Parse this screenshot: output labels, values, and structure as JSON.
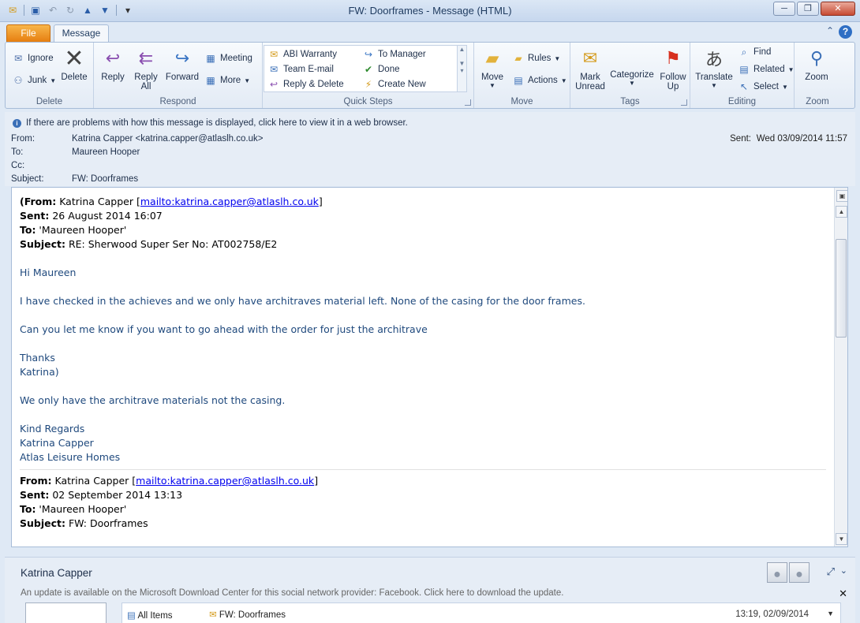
{
  "window": {
    "title": "FW: Doorframes  -  Message (HTML)",
    "minimize": "─",
    "maximize": "❐",
    "close": "✕"
  },
  "tabs": {
    "file": "File",
    "message": "Message"
  },
  "ribbon": {
    "delete_group": {
      "label": "Delete",
      "ignore": "Ignore",
      "junk": "Junk",
      "delete": "Delete"
    },
    "respond_group": {
      "label": "Respond",
      "reply": "Reply",
      "reply_all_1": "Reply",
      "reply_all_2": "All",
      "forward": "Forward",
      "meeting": "Meeting",
      "more": "More"
    },
    "quick_steps": {
      "label": "Quick Steps",
      "items": [
        "ABI Warranty",
        "Team E-mail",
        "Reply & Delete",
        "To Manager",
        "Done",
        "Create New"
      ]
    },
    "move_group": {
      "label": "Move",
      "move": "Move",
      "rules": "Rules",
      "actions": "Actions"
    },
    "tags_group": {
      "label": "Tags",
      "mark_unread_1": "Mark",
      "mark_unread_2": "Unread",
      "categorize": "Categorize",
      "follow_up_1": "Follow",
      "follow_up_2": "Up"
    },
    "editing_group": {
      "label": "Editing",
      "translate": "Translate",
      "find": "Find",
      "related": "Related",
      "select": "Select"
    },
    "zoom_group": {
      "label": "Zoom",
      "zoom": "Zoom"
    }
  },
  "header": {
    "info_bar": "If there are problems with how this message is displayed, click here to view it in a web browser.",
    "from_label": "From:",
    "from_value": "Katrina Capper <katrina.capper@atlaslh.co.uk>",
    "to_label": "To:",
    "to_value": "Maureen Hooper",
    "cc_label": "Cc:",
    "subject_label": "Subject:",
    "subject_value": "FW: Doorframes",
    "sent_label": "Sent:",
    "sent_value": "Wed 03/09/2014 11:57"
  },
  "message": {
    "q1_from_label": "(From:",
    "q1_from_name": " Katrina Capper [",
    "q1_from_link": "mailto:katrina.capper@atlaslh.co.uk",
    "q1_from_end": "]",
    "q1_sent_label": "Sent:",
    "q1_sent_value": " 26 August 2014 16:07",
    "q1_to_label": "To:",
    "q1_to_value": " 'Maureen Hooper'",
    "q1_subject_label": "Subject:",
    "q1_subject_value": " RE: Sherwood Super Ser No: AT002758/E2",
    "greeting": "Hi Maureen",
    "para1": "I have checked in the achieves and we only have architraves material left.  None of the casing for the door frames.",
    "para2": "Can you let me know if you want to go ahead with the order for just the architrave",
    "thanks": "Thanks",
    "sig1": "Katrina)",
    "para3": "We only have the architrave materials not the casing.",
    "regards": "Kind Regards",
    "regards_name": "Katrina Capper",
    "regards_company": "Atlas Leisure Homes",
    "q2_from_label": "From:",
    "q2_from_name": " Katrina Capper [",
    "q2_from_link": "mailto:katrina.capper@atlaslh.co.uk",
    "q2_from_end": "]",
    "q2_sent_label": "Sent:",
    "q2_sent_value": " 02 September 2014 13:13",
    "q2_to_label": "To:",
    "q2_to_value": " 'Maureen Hooper'",
    "q2_subject_label": "Subject:",
    "q2_subject_value": " FW: Doorframes"
  },
  "people_pane": {
    "name": "Katrina Capper",
    "update_msg": "An update is available on the Microsoft Download Center for this social network provider: Facebook. Click here to download the update.",
    "all_items": "All Items",
    "item_subject": "FW: Doorframes",
    "item_time": "13:19, 02/09/2014"
  },
  "colors": {
    "accent": "#1f497d",
    "link": "#0000ee",
    "file_tab": "#e67e10"
  }
}
